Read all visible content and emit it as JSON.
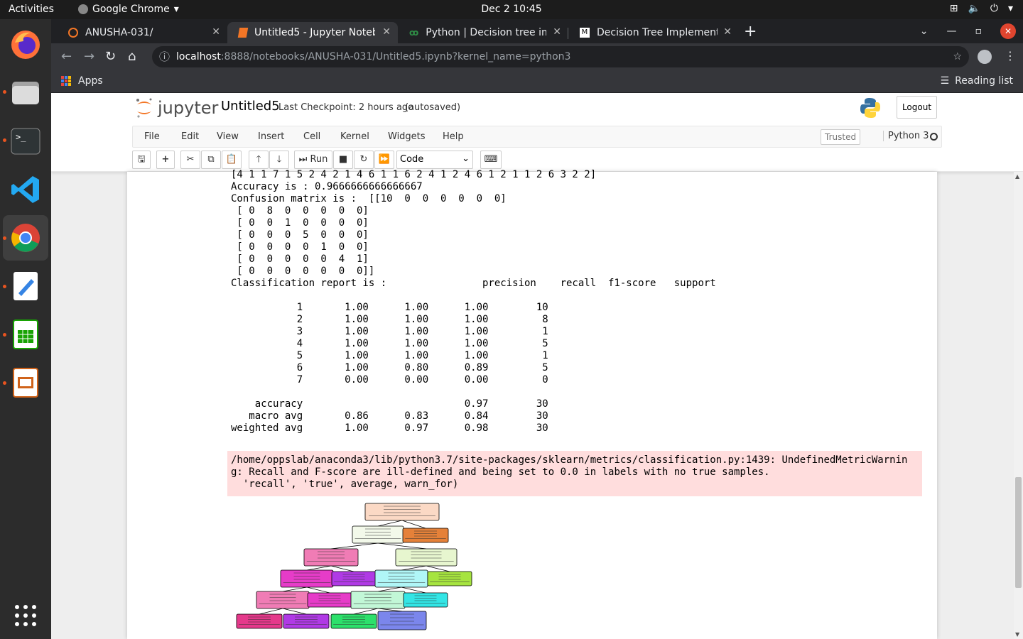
{
  "topbar": {
    "activities": "Activities",
    "app_name": "Google Chrome",
    "clock": "Dec 2  10:45"
  },
  "chrome": {
    "tabs": [
      {
        "title": "ANUSHA-031/",
        "icon": "jupyter-icon"
      },
      {
        "title": "Untitled5 - Jupyter Noteb",
        "icon": "jupyter-book-icon"
      },
      {
        "title": "Python | Decision tree imp",
        "icon": "gfg-icon"
      },
      {
        "title": "Decision Tree Implementa",
        "icon": "medium-icon"
      }
    ],
    "url_host": "localhost",
    "url_rest": ":8888/notebooks/ANUSHA-031/Untitled5.ipynb?kernel_name=python3",
    "bookmarks_apps": "Apps",
    "reading_list": "Reading list"
  },
  "jupyter": {
    "logo_text": "jupyter",
    "notebook_name": "Untitled5",
    "checkpoint": "Last Checkpoint: 2 hours ago",
    "autosave": "(autosaved)",
    "logout": "Logout",
    "menu": [
      "File",
      "Edit",
      "View",
      "Insert",
      "Cell",
      "Kernel",
      "Widgets",
      "Help"
    ],
    "trusted": "Trusted",
    "kernel": "Python 3",
    "run_label": "Run",
    "cell_type": "Code"
  },
  "output": {
    "lines": [
      "[4 1 1 7 1 5 2 4 2 1 4 6 1 1 6 2 4 1 2 4 6 1 2 1 1 2 6 3 2 2]",
      "Accuracy is : 0.9666666666666667",
      "Confusion matrix is :  [[10  0  0  0  0  0  0]",
      " [ 0  8  0  0  0  0  0]",
      " [ 0  0  1  0  0  0  0]",
      " [ 0  0  0  5  0  0  0]",
      " [ 0  0  0  0  1  0  0]",
      " [ 0  0  0  0  0  4  1]",
      " [ 0  0  0  0  0  0  0]]",
      "Classification report is :                precision    recall  f1-score   support",
      "",
      "           1       1.00      1.00      1.00        10",
      "           2       1.00      1.00      1.00         8",
      "           3       1.00      1.00      1.00         1",
      "           4       1.00      1.00      1.00         5",
      "           5       1.00      1.00      1.00         1",
      "           6       1.00      0.80      0.89         5",
      "           7       0.00      0.00      0.00         0",
      "",
      "    accuracy                           0.97        30",
      "   macro avg       0.86      0.83      0.84        30",
      "weighted avg       1.00      0.97      0.98        30"
    ],
    "warning": "/home/oppslab/anaconda3/lib/python3.7/site-packages/sklearn/metrics/classification.py:1439: UndefinedMetricWarnin\ng: Recall and F-score are ill-defined and being set to 0.0 in labels with no true samples.\n  'recall', 'true', average, warn_for)"
  },
  "tree_colors": {
    "root": "#fbd9c5",
    "orange": "#e58139",
    "light": "#f3f9ea",
    "pink": "#f07cb5",
    "lime": "#e7f6cf",
    "magenta": "#e63cc8",
    "purple": "#b03ae5",
    "cyan": "#b0f6f7",
    "green": "#a6e43f",
    "mint": "#c2f7d7",
    "aqua": "#33e5e5",
    "hotpink": "#e5398b",
    "deepgreen": "#2de06b",
    "blue": "#7b86ec"
  }
}
